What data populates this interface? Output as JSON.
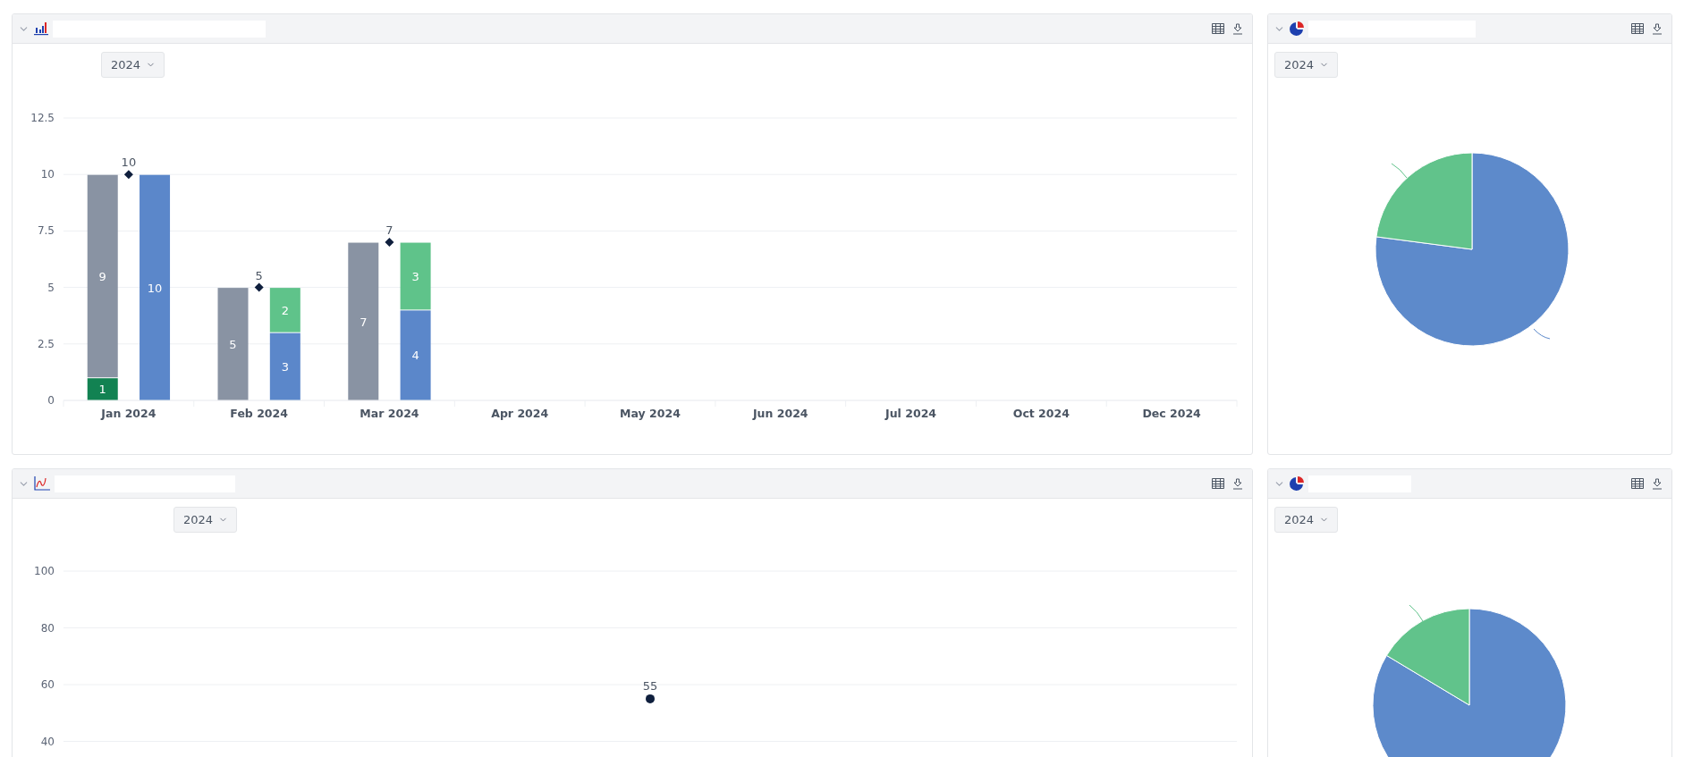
{
  "panels": [
    {
      "kind": "bar",
      "year_filter": "2024",
      "chart_data": {
        "type": "bar",
        "stacked": true,
        "data_labels": true,
        "grid": true,
        "categories": [
          null,
          null,
          "Jan 2024",
          null,
          null,
          null,
          null,
          "Feb 2024",
          null,
          null,
          null,
          null,
          "Mar 2024",
          null,
          null,
          null,
          null,
          "Apr 2024",
          null,
          null,
          null,
          null,
          "May 2024",
          null,
          null,
          null,
          null,
          "Jun 2024",
          null,
          null,
          null,
          null,
          "Jul 2024",
          null,
          null,
          null,
          null,
          "Oct 2024",
          null,
          null,
          null,
          null,
          "Dec 2024",
          null,
          null
        ],
        "ylim": [
          0,
          12.5
        ],
        "yticks": [
          0,
          {
            "value": 2.5,
            "label": "2.5"
          },
          5,
          {
            "value": 7.5,
            "label": "7.5"
          },
          10,
          {
            "value": 12.5,
            "label": "12.5"
          }
        ],
        "series": [
          {
            "type": "bar",
            "color": "#128252",
            "values": [
              null,
              1,
              null,
              null,
              null,
              null,
              null,
              null,
              null,
              null,
              null,
              null,
              null,
              null,
              null,
              null,
              null,
              null,
              null,
              null,
              null,
              null,
              null,
              null,
              null,
              null,
              null,
              null,
              null,
              null,
              null,
              null,
              null,
              null,
              null,
              null,
              null,
              null,
              null,
              null,
              null,
              null,
              null,
              null,
              null
            ]
          },
          {
            "type": "bar",
            "color": "#8993a3",
            "values": [
              null,
              9,
              null,
              null,
              null,
              null,
              5,
              null,
              null,
              null,
              null,
              7,
              null,
              null,
              null,
              null,
              null,
              null,
              null,
              null,
              null,
              null,
              null,
              null,
              null,
              null,
              null,
              null,
              null,
              null,
              null,
              null,
              null,
              null,
              null,
              null,
              null,
              null,
              null,
              null,
              null,
              null,
              null,
              null,
              null
            ]
          },
          {
            "type": "bar",
            "color": "#5b87ca",
            "values": [
              null,
              null,
              null,
              10,
              null,
              null,
              null,
              null,
              3,
              null,
              null,
              null,
              null,
              4,
              null,
              null,
              null,
              null,
              null,
              null,
              null,
              null,
              null,
              null,
              null,
              null,
              null,
              null,
              null,
              null,
              null,
              null,
              null,
              null,
              null,
              null,
              null,
              null,
              null,
              null,
              null,
              null,
              null,
              null,
              null
            ]
          },
          {
            "type": "bar",
            "color": "#5fc38a",
            "values": [
              null,
              null,
              null,
              null,
              null,
              null,
              null,
              null,
              2,
              null,
              null,
              null,
              null,
              3,
              null,
              null,
              null,
              null,
              null,
              null,
              null,
              null,
              null,
              null,
              null,
              null,
              null,
              null,
              null,
              null,
              null,
              null,
              null,
              null,
              null,
              null,
              null,
              null,
              null,
              null,
              null,
              null,
              null,
              null,
              null
            ]
          },
          {
            "type": "scatter",
            "color": "#0f1f3d",
            "values": [
              null,
              null,
              10,
              null,
              null,
              null,
              null,
              5,
              null,
              null,
              null,
              null,
              7,
              null,
              null,
              null,
              null,
              null,
              null,
              null,
              null,
              null,
              null,
              null,
              null,
              null,
              null,
              null,
              null,
              null,
              null,
              null,
              null,
              null,
              null,
              null,
              null,
              null,
              null,
              null,
              null,
              null,
              null,
              null,
              null
            ]
          }
        ]
      }
    },
    {
      "kind": "pie",
      "year_filter": "2024"
    },
    {
      "kind": "line",
      "year_filter": "2024",
      "chart_data": {
        "type": "line",
        "data_labels": true,
        "grid": true,
        "ylim": [
          40,
          100
        ],
        "yticks": [
          40,
          60,
          80,
          100
        ],
        "series": [
          {
            "color": "#0f1f3d",
            "marker": true,
            "values": [
              55
            ]
          }
        ]
      }
    },
    {
      "kind": "pie",
      "year_filter": "2024"
    }
  ]
}
